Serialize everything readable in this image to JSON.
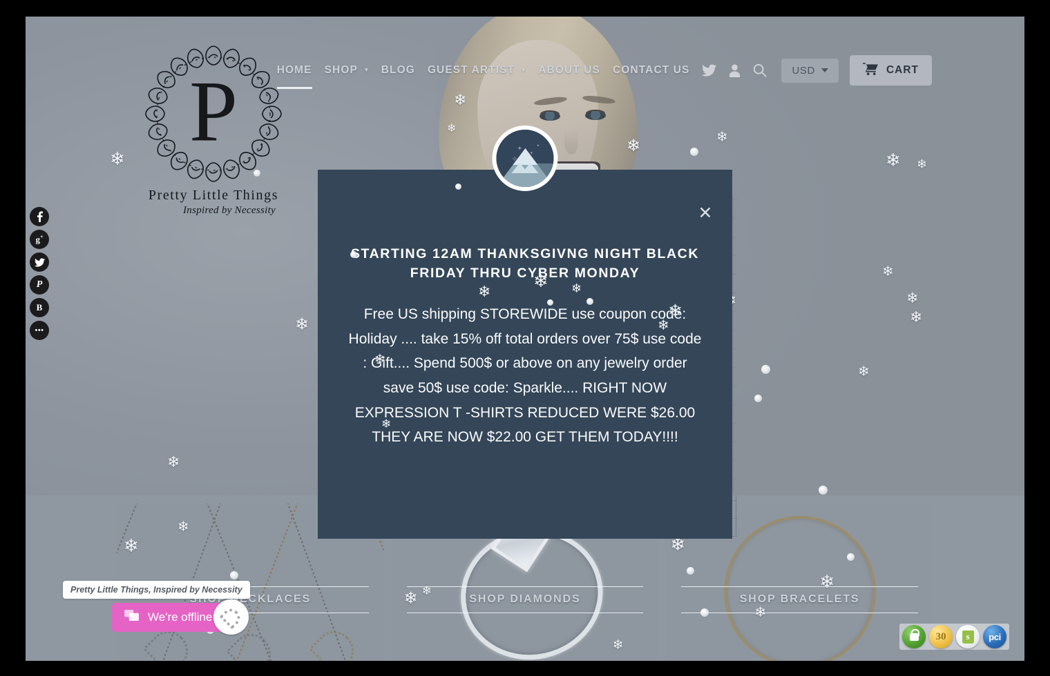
{
  "site": {
    "logo_letter": "P",
    "logo_name": "Pretty Little Things",
    "logo_tagline": "Inspired by Necessity"
  },
  "nav": {
    "items": [
      {
        "label": "HOME",
        "has_caret": false,
        "active": true
      },
      {
        "label": "SHOP",
        "has_caret": true,
        "active": false
      },
      {
        "label": "BLOG",
        "has_caret": false,
        "active": false
      },
      {
        "label": "GUEST ARTIST",
        "has_caret": true,
        "active": false
      },
      {
        "label": "ABOUT US",
        "has_caret": false,
        "active": false
      },
      {
        "label": "CONTACT US",
        "has_caret": false,
        "active": false
      }
    ],
    "icons": [
      {
        "name": "twitter-icon",
        "glyph": "\u0000"
      },
      {
        "name": "account-icon",
        "glyph": "\u0000"
      },
      {
        "name": "search-icon",
        "glyph": "\u0000"
      }
    ],
    "currency": {
      "value": "USD"
    },
    "cart": {
      "label": "CART"
    },
    "caret_glyph": "▾"
  },
  "social": {
    "items": [
      {
        "name": "facebook",
        "glyph": "f"
      },
      {
        "name": "google-plus",
        "glyph": "g⁺"
      },
      {
        "name": "twitter",
        "glyph": "\u0000"
      },
      {
        "name": "pinterest",
        "glyph": "\u0000"
      },
      {
        "name": "blogger",
        "glyph": "B"
      },
      {
        "name": "more",
        "glyph": "•••"
      }
    ]
  },
  "modal": {
    "badge_icon": "winter-mountain-icon",
    "close_glyph": "✕",
    "heading": "STARTING 12AM THANKSGIVNG NIGHT BLACK FRIDAY THRU CYBER MONDAY",
    "body": "Free US shipping STOREWIDE use coupon code: Holiday .... take 15% off total orders over 75$ use code : Gift.... Spend 500$ or above on any jewelry order save 50$ use code: Sparkle.... RIGHT NOW EXPRESSION T -SHIRTS REDUCED WERE $26.00 THEY ARE NOW $22.00 GET THEM TODAY!!!!",
    "background_color": "#344658"
  },
  "product_strip": {
    "cards": [
      {
        "label": "SHOP NECKLACES",
        "art": "heart-necklaces"
      },
      {
        "label": "SHOP DIAMONDS",
        "art": "diamond-ring"
      },
      {
        "label": "SHOP BRACELETS",
        "art": "gold-bangle"
      }
    ]
  },
  "chat": {
    "tooltip": "Pretty Little Things, Inspired by Necessity",
    "button_label": "We're offline",
    "button_color": "#e563c5",
    "icon": "chat-bubbles-icon"
  },
  "trust_badges": [
    {
      "name": "secure-lock-badge",
      "label": ""
    },
    {
      "name": "30-day-guarantee-badge",
      "label": "30"
    },
    {
      "name": "shopify-badge",
      "label": "s"
    },
    {
      "name": "pci-compliant-badge",
      "label": "pci"
    }
  ],
  "colors": {
    "hero_bg": "#8f97a1",
    "modal_bg": "#344658",
    "nav_text": "#cfd3d8",
    "chat_pink": "#e563c5"
  }
}
